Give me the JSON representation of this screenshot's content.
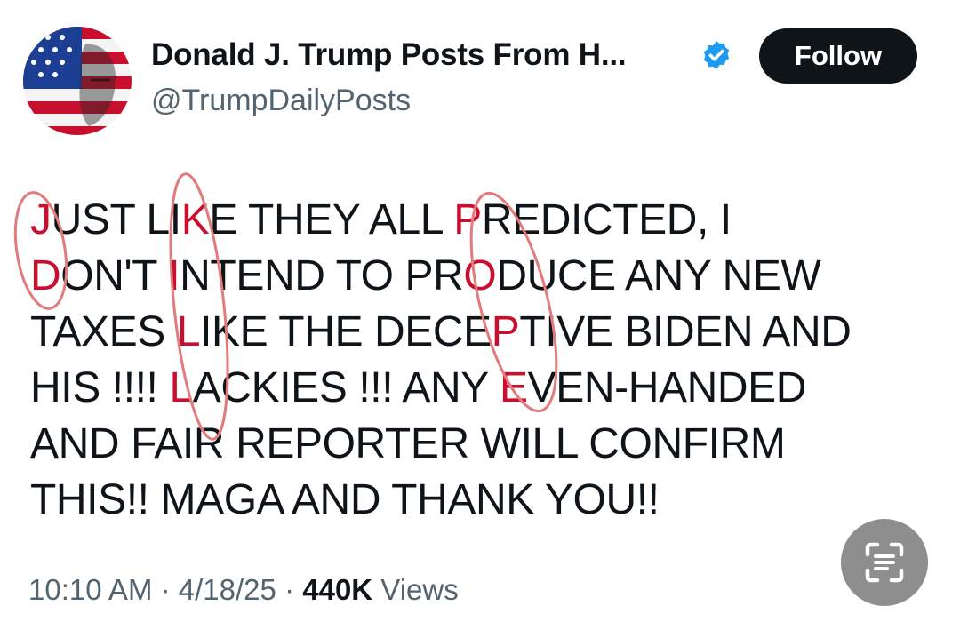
{
  "post": {
    "author": {
      "display_name": "Donald J. Trump Posts From H...",
      "handle": "@TrumpDailyPosts",
      "verified": true,
      "avatar_icon": "flag-portrait-avatar",
      "verified_icon": "verified-badge-icon"
    },
    "follow_label": "Follow",
    "lines": [
      [
        {
          "t": "J",
          "hl": true
        },
        {
          "t": "UST LI"
        },
        {
          "t": "K",
          "hl": true
        },
        {
          "t": "E THEY ALL "
        },
        {
          "t": "P",
          "hl": true
        },
        {
          "t": "REDICTED, I"
        }
      ],
      [
        {
          "t": "D",
          "hl": true
        },
        {
          "t": "ON'T "
        },
        {
          "t": "I",
          "hl": true
        },
        {
          "t": "NTEND TO PR"
        },
        {
          "t": "O",
          "hl": true
        },
        {
          "t": "DUCE ANY NEW"
        }
      ],
      [
        {
          "t": "TAXES "
        },
        {
          "t": "L",
          "hl": true
        },
        {
          "t": "IKE THE DECE"
        },
        {
          "t": "P",
          "hl": true
        },
        {
          "t": "TIVE BIDEN AND"
        }
      ],
      [
        {
          "t": "HIS !!!! "
        },
        {
          "t": "L",
          "hl": true
        },
        {
          "t": "ACKIES !!! ANY "
        },
        {
          "t": "E",
          "hl": true
        },
        {
          "t": "VEN-HANDED"
        }
      ],
      [
        {
          "t": "AND FAIR REPORTER WILL CONFIRM"
        }
      ],
      [
        {
          "t": "THIS!! MAGA AND THANK YOU!!"
        }
      ]
    ],
    "time": "10:10 AM",
    "separator": "·",
    "date": "4/18/25",
    "views_count": "440K",
    "views_label": "Views"
  },
  "overlay": {
    "scan_icon": "text-scan-icon"
  },
  "colors": {
    "highlight": "#c8102e",
    "annotation": "#e27b7b",
    "follow_bg": "#0f1419",
    "verified": "#1d9bf0",
    "muted": "#536471"
  }
}
